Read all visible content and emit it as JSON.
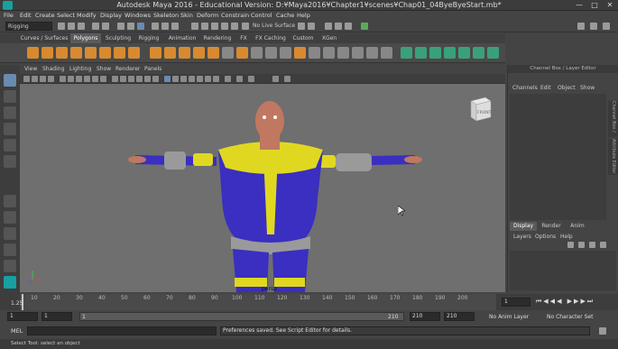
{
  "window": {
    "title": "Autodesk Maya 2016 - Educational Version: D:¥Maya2016¥Chapter1¥scenes¥Chap01_04ByeByeStart.mb*",
    "minimize": "—",
    "maximize": "□",
    "close": "✕"
  },
  "menu": [
    "File",
    "Edit",
    "Create",
    "Select",
    "Modify",
    "Display",
    "Windows",
    "Skeleton",
    "Skin",
    "Deform",
    "Constrain",
    "Control",
    "Cache",
    "Help"
  ],
  "statusline": {
    "menuset": "Rigging",
    "live_surface": "No Live Surface"
  },
  "shelf_tabs": [
    "Curves / Surfaces",
    "Polygons",
    "Sculpting",
    "Rigging",
    "Animation",
    "Rendering",
    "FX",
    "FX Caching",
    "Custom",
    "XGen"
  ],
  "shelf_active": "Polygons",
  "viewport": {
    "menu": [
      "View",
      "Shading",
      "Lighting",
      "Show",
      "Renderer",
      "Panels"
    ],
    "cube_label": "FRONT",
    "camera_label": "persp"
  },
  "right_panel": {
    "title": "Channel Box / Layer Editor",
    "channel_menu": [
      "Channels",
      "Edit",
      "Object",
      "Show"
    ],
    "layer_tabs": [
      "Display",
      "Render",
      "Anim"
    ],
    "layer_menu": [
      "Layers",
      "Options",
      "Help"
    ],
    "side_tab_1": "Channel Box / Layer Editor",
    "side_tab_2": "Attribute Editor"
  },
  "timeslider": {
    "ticks": [
      "10",
      "20",
      "30",
      "40",
      "50",
      "60",
      "70",
      "80",
      "90",
      "100",
      "110",
      "120",
      "130",
      "140",
      "150",
      "160",
      "170",
      "180",
      "190",
      "200"
    ],
    "current_frame": "1.25",
    "current_field": "1"
  },
  "range": {
    "start": "1",
    "playback_start": "1",
    "slider_start": "1",
    "slider_end": "210",
    "playback_end": "210",
    "end": "210",
    "anim_layer": "No Anim Layer",
    "character_set": "No Character Set"
  },
  "cmdline": {
    "lang": "MEL",
    "result": "Preferences saved. See Script Editor for details."
  },
  "helpline": "Select Tool: select an object",
  "colors": {
    "suit_blue": "#3a2fc0",
    "suit_yellow": "#e0d820",
    "skin": "#c07860",
    "armor_gray": "#9a9a9a",
    "accent": "#5d8ab8"
  }
}
